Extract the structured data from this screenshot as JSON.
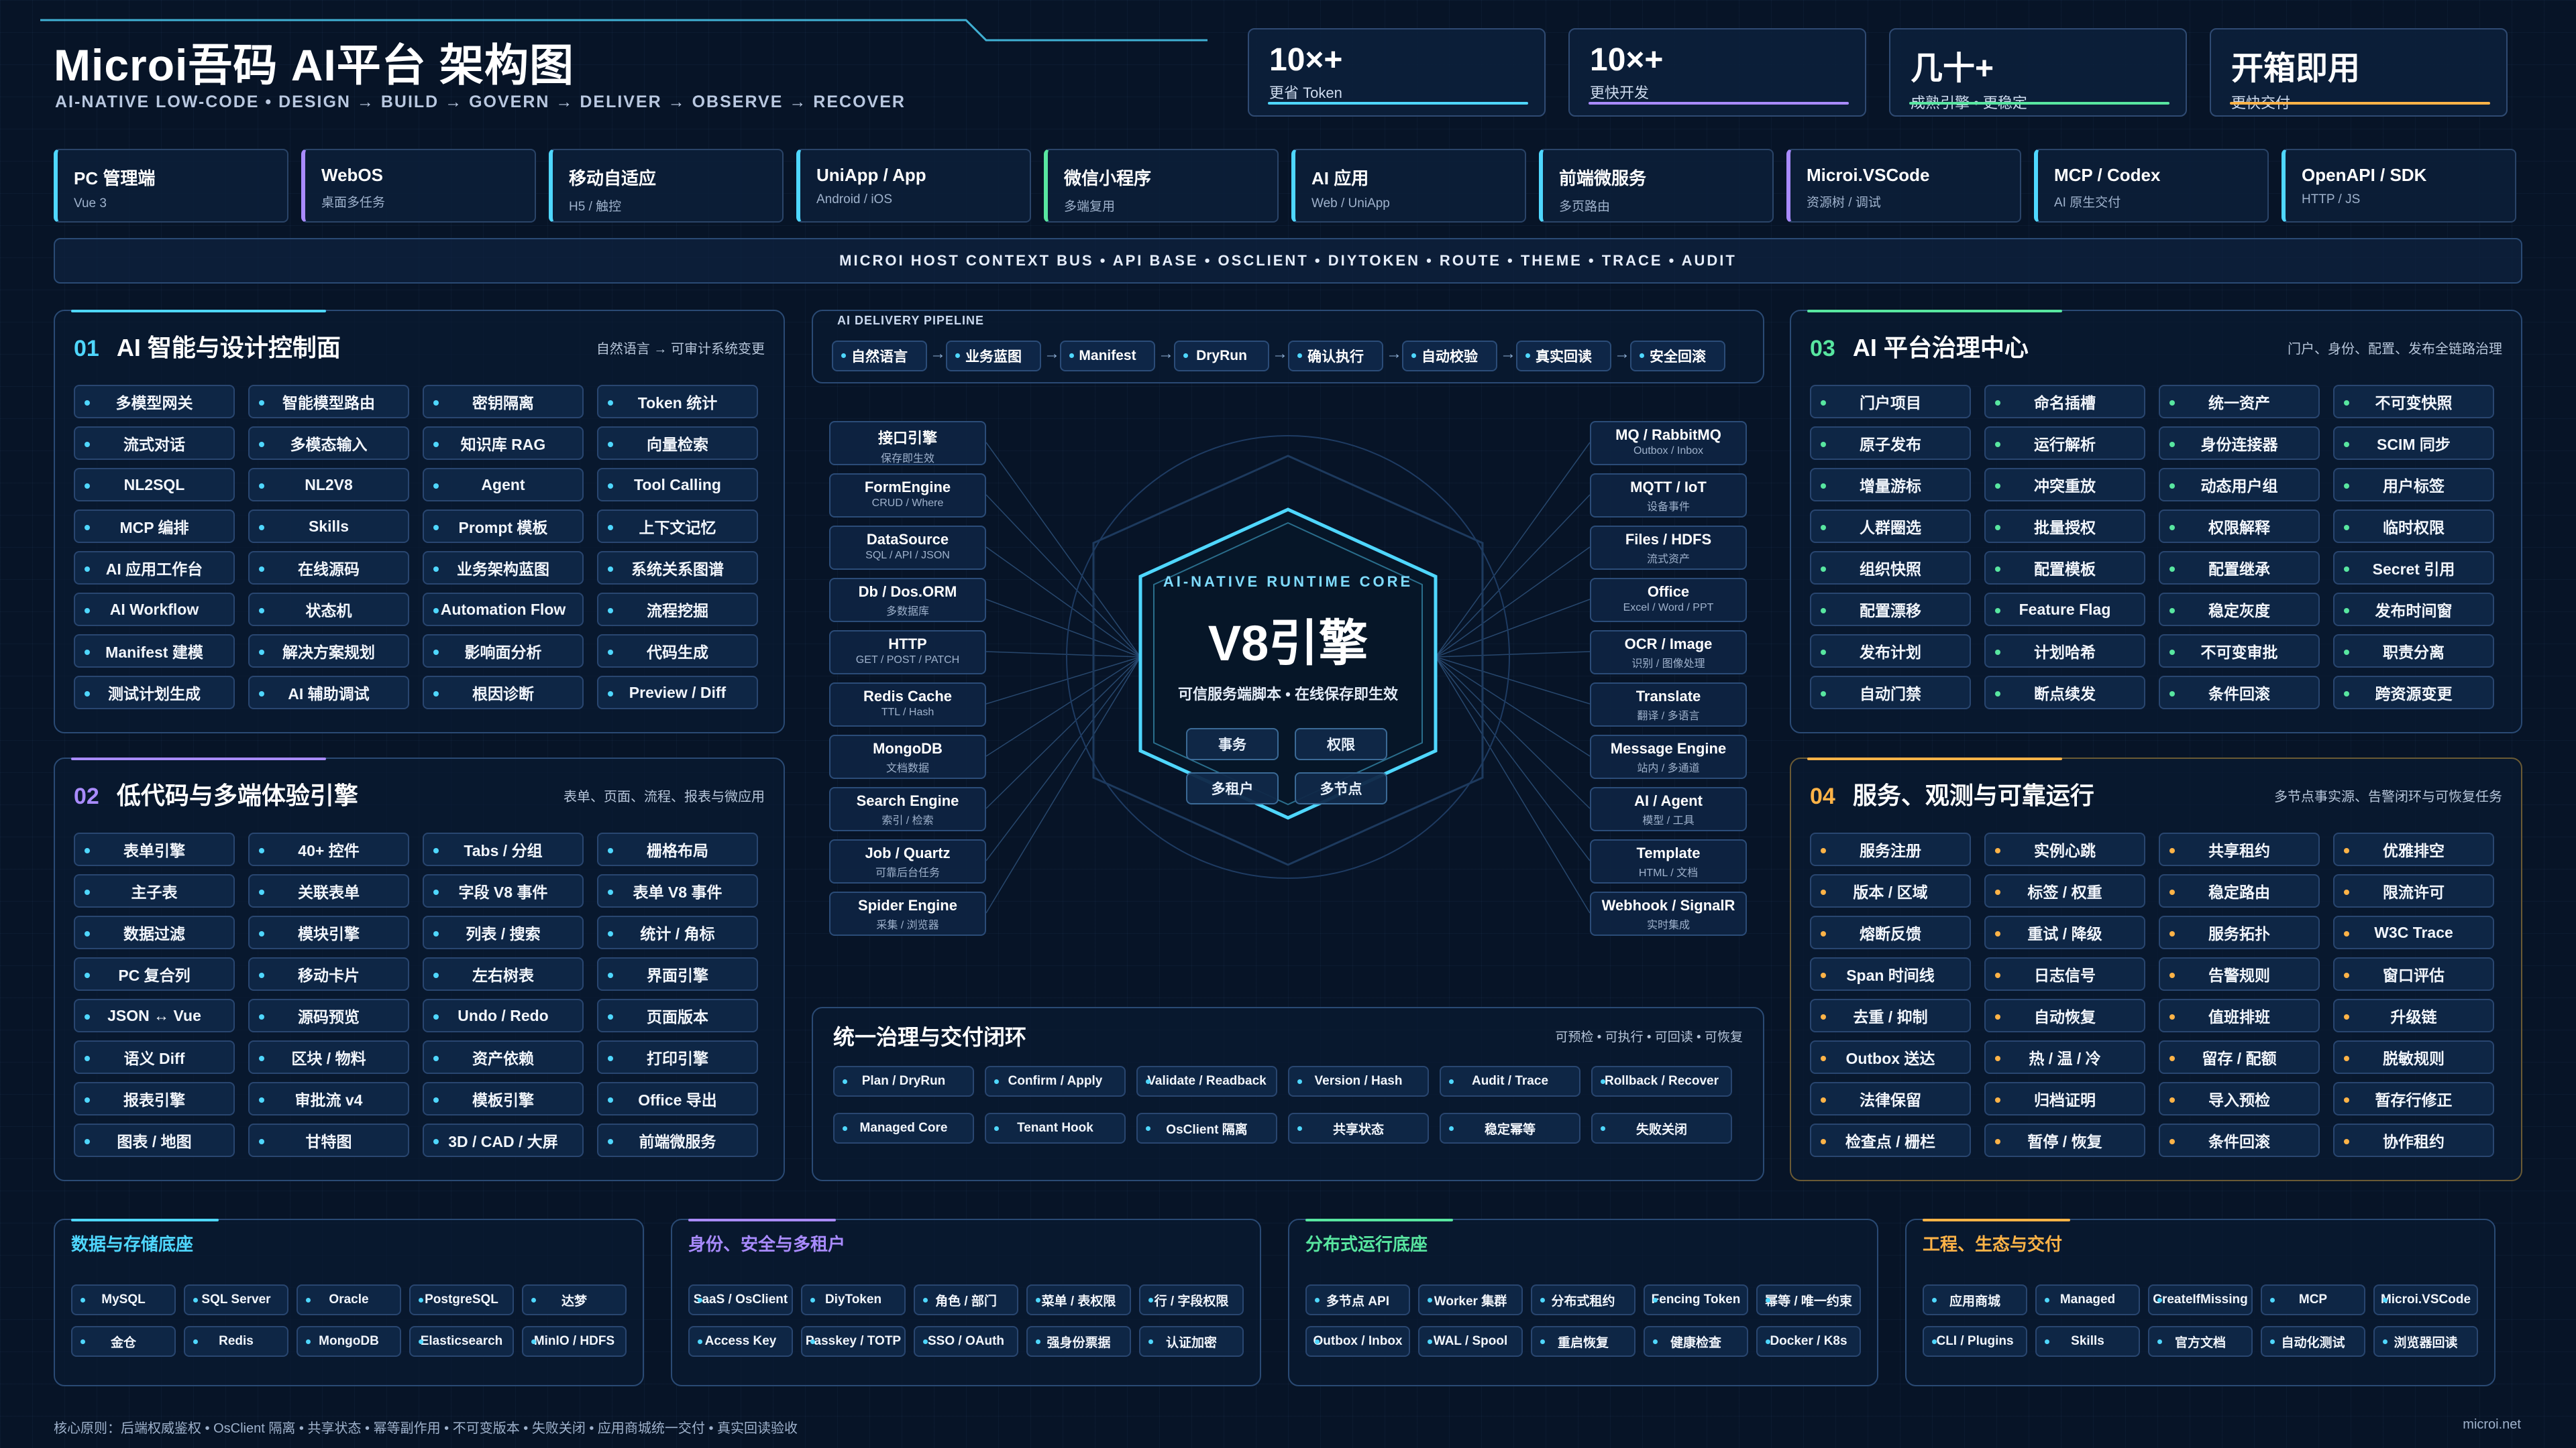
{
  "header": {
    "title": "Microi吾码 AI平台 架构图",
    "subtitle": "AI-NATIVE LOW-CODE • DESIGN → BUILD → GOVERN → DELIVER → OBSERVE → RECOVER"
  },
  "stats": [
    {
      "value": "10×+",
      "label": "更省 Token",
      "color": "#4fd7ff"
    },
    {
      "value": "10×+",
      "label": "更快开发",
      "color": "#a98bff"
    },
    {
      "value": "几十+",
      "label": "成熟引擎 • 更稳定",
      "color": "#58e6a0"
    },
    {
      "value": "开箱即用",
      "label": "更快交付",
      "color": "#ffb347"
    }
  ],
  "platforms": [
    {
      "name": "PC 管理端",
      "sub": "Vue 3",
      "color": "#4fd7ff"
    },
    {
      "name": "WebOS",
      "sub": "桌面多任务",
      "color": "#a98bff"
    },
    {
      "name": "移动自适应",
      "sub": "H5 / 触控",
      "color": "#4fd7ff"
    },
    {
      "name": "UniApp / App",
      "sub": "Android / iOS",
      "color": "#4fd7ff"
    },
    {
      "name": "微信小程序",
      "sub": "多端复用",
      "color": "#58e6a0"
    },
    {
      "name": "AI 应用",
      "sub": "Web / UniApp",
      "color": "#4fd7ff"
    },
    {
      "name": "前端微服务",
      "sub": "多页路由",
      "color": "#4fd7ff"
    },
    {
      "name": "Microi.VSCode",
      "sub": "资源树 / 调试",
      "color": "#a98bff"
    },
    {
      "name": "MCP / Codex",
      "sub": "AI 原生交付",
      "color": "#4fd7ff"
    },
    {
      "name": "OpenAPI / SDK",
      "sub": "HTTP / JS",
      "color": "#4fd7ff"
    }
  ],
  "bus": "MICROI HOST CONTEXT BUS • API BASE • OSCLIENT • DIYTOKEN • ROUTE • THEME • TRACE • AUDIT",
  "panel01": {
    "num": "01",
    "title": "AI 智能与设计控制面",
    "right": "自然语言 → 可审计系统变更",
    "items": [
      "多模型网关",
      "智能模型路由",
      "密钥隔离",
      "Token 统计",
      "流式对话",
      "多模态输入",
      "知识库 RAG",
      "向量检索",
      "NL2SQL",
      "NL2V8",
      "Agent",
      "Tool Calling",
      "MCP 编排",
      "Skills",
      "Prompt 模板",
      "上下文记忆",
      "AI 应用工作台",
      "在线源码",
      "业务架构蓝图",
      "系统关系图谱",
      "AI Workflow",
      "状态机",
      "Automation Flow",
      "流程挖掘",
      "Manifest 建模",
      "解决方案规划",
      "影响面分析",
      "代码生成",
      "测试计划生成",
      "AI 辅助调试",
      "根因诊断",
      "Preview / Diff"
    ]
  },
  "panel02": {
    "num": "02",
    "title": "低代码与多端体验引擎",
    "right": "表单、页面、流程、报表与微应用",
    "items": [
      "表单引擎",
      "40+ 控件",
      "Tabs / 分组",
      "栅格布局",
      "主子表",
      "关联表单",
      "字段 V8 事件",
      "表单 V8 事件",
      "数据过滤",
      "模块引擎",
      "列表 / 搜索",
      "统计 / 角标",
      "PC 复合列",
      "移动卡片",
      "左右树表",
      "界面引擎",
      "JSON ↔ Vue",
      "源码预览",
      "Undo / Redo",
      "页面版本",
      "语义 Diff",
      "区块 / 物料",
      "资产依赖",
      "打印引擎",
      "报表引擎",
      "审批流 v4",
      "模板引擎",
      "Office 导出",
      "图表 / 地图",
      "甘特图",
      "3D / CAD / 大屏",
      "前端微服务"
    ]
  },
  "panel03": {
    "num": "03",
    "title": "AI 平台治理中心",
    "right": "门户、身份、配置、发布全链路治理",
    "items": [
      "门户项目",
      "命名插槽",
      "统一资产",
      "不可变快照",
      "原子发布",
      "运行解析",
      "身份连接器",
      "SCIM 同步",
      "增量游标",
      "冲突重放",
      "动态用户组",
      "用户标签",
      "人群圈选",
      "批量授权",
      "权限解释",
      "临时权限",
      "组织快照",
      "配置模板",
      "配置继承",
      "Secret 引用",
      "配置漂移",
      "Feature Flag",
      "稳定灰度",
      "发布时间窗",
      "发布计划",
      "计划哈希",
      "不可变审批",
      "职责分离",
      "自动门禁",
      "断点续发",
      "条件回滚",
      "跨资源变更"
    ]
  },
  "panel04": {
    "num": "04",
    "title": "服务、观测与可靠运行",
    "right": "多节点事实源、告警闭环与可恢复任务",
    "items": [
      "服务注册",
      "实例心跳",
      "共享租约",
      "优雅排空",
      "版本 / 区域",
      "标签 / 权重",
      "稳定路由",
      "限流许可",
      "熔断反馈",
      "重试 / 降级",
      "服务拓扑",
      "W3C Trace",
      "Span 时间线",
      "日志信号",
      "告警规则",
      "窗口评估",
      "去重 / 抑制",
      "自动恢复",
      "值班排班",
      "升级链",
      "Outbox 送达",
      "热 / 温 / 冷",
      "留存 / 配额",
      "脱敏规则",
      "法律保留",
      "归档证明",
      "导入预检",
      "暂存行修正",
      "检查点 / 栅栏",
      "暂停 / 恢复",
      "条件回滚",
      "协作租约"
    ]
  },
  "pipeline": {
    "label": "AI DELIVERY PIPELINE",
    "steps": [
      "自然语言",
      "业务蓝图",
      "Manifest",
      "DryRun",
      "确认执行",
      "自动校验",
      "真实回读",
      "安全回滚"
    ]
  },
  "engines_left": [
    {
      "a": "接口引擎",
      "b": "保存即生效"
    },
    {
      "a": "FormEngine",
      "b": "CRUD / Where"
    },
    {
      "a": "DataSource",
      "b": "SQL / API / JSON"
    },
    {
      "a": "Db / Dos.ORM",
      "b": "多数据库"
    },
    {
      "a": "HTTP",
      "b": "GET / POST / PATCH"
    },
    {
      "a": "Redis Cache",
      "b": "TTL / Hash"
    },
    {
      "a": "MongoDB",
      "b": "文档数据"
    },
    {
      "a": "Search Engine",
      "b": "索引 / 检索"
    },
    {
      "a": "Job / Quartz",
      "b": "可靠后台任务"
    },
    {
      "a": "Spider Engine",
      "b": "采集 / 浏览器"
    }
  ],
  "engines_right": [
    {
      "a": "MQ / RabbitMQ",
      "b": "Outbox / Inbox"
    },
    {
      "a": "MQTT / IoT",
      "b": "设备事件"
    },
    {
      "a": "Files / HDFS",
      "b": "流式资产"
    },
    {
      "a": "Office",
      "b": "Excel / Word / PPT"
    },
    {
      "a": "OCR / Image",
      "b": "识别 / 图像处理"
    },
    {
      "a": "Translate",
      "b": "翻译 / 多语言"
    },
    {
      "a": "Message Engine",
      "b": "站内 / 多通道"
    },
    {
      "a": "AI / Agent",
      "b": "模型 / 工具"
    },
    {
      "a": "Template",
      "b": "HTML / 文档"
    },
    {
      "a": "Webhook / SignalR",
      "b": "实时集成"
    }
  ],
  "core": {
    "label": "AI-NATIVE RUNTIME CORE",
    "title": "V8引擎",
    "desc": "可信服务端脚本 • 在线保存即生效",
    "buttons": [
      "事务",
      "权限",
      "多租户",
      "多节点"
    ]
  },
  "govern": {
    "title": "统一治理与交付闭环",
    "right": "可预检 • 可执行 • 可回读 • 可恢复",
    "items": [
      "Plan / DryRun",
      "Confirm / Apply",
      "Validate / Readback",
      "Version / Hash",
      "Audit / Trace",
      "Rollback / Recover",
      "Managed Core",
      "Tenant Hook",
      "OsClient 隔离",
      "共享状态",
      "稳定幂等",
      "失败关闭"
    ]
  },
  "bottom": [
    {
      "title": "数据与存储底座",
      "color": "#4fd7ff",
      "items": [
        "MySQL",
        "SQL Server",
        "Oracle",
        "PostgreSQL",
        "达梦",
        "金仓",
        "Redis",
        "MongoDB",
        "Elasticsearch",
        "MinIO / HDFS"
      ]
    },
    {
      "title": "身份、安全与多租户",
      "color": "#a98bff",
      "items": [
        "SaaS / OsClient",
        "DiyToken",
        "角色 / 部门",
        "菜单 / 表权限",
        "行 / 字段权限",
        "Access Key",
        "Passkey / TOTP",
        "SSO / OAuth",
        "强身份票据",
        "认证加密"
      ]
    },
    {
      "title": "分布式运行底座",
      "color": "#58e6a0",
      "items": [
        "多节点 API",
        "Worker 集群",
        "分布式租约",
        "Fencing Token",
        "幂等 / 唯一约束",
        "Outbox / Inbox",
        "WAL / Spool",
        "重启恢复",
        "健康检查",
        "Docker / K8s"
      ]
    },
    {
      "title": "工程、生态与交付",
      "color": "#ffb347",
      "items": [
        "应用商城",
        "Managed",
        "CreateIfMissing",
        "MCP",
        "Microi.VSCode",
        "CLI / Plugins",
        "Skills",
        "官方文档",
        "自动化测试",
        "浏览器回读"
      ]
    }
  ],
  "footer": {
    "left": "核心原则：后端权威鉴权 • OsClient 隔离 • 共享状态 • 幂等副作用 • 不可变版本 • 失败关闭 • 应用商城统一交付 • 真实回读验收",
    "right": "microi.net"
  }
}
